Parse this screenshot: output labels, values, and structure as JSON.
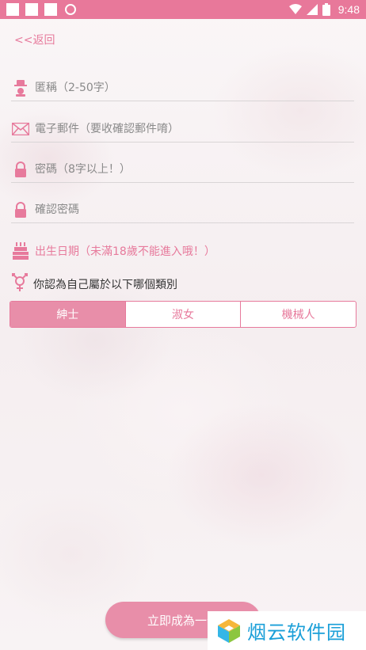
{
  "status_bar": {
    "time": "9:48",
    "icons": [
      "notification-square-icon",
      "notification-square-icon",
      "notification-square-icon",
      "sync-circle-icon",
      "wifi-icon",
      "signal-icon",
      "battery-icon"
    ]
  },
  "nav": {
    "back_label": "<<返回"
  },
  "form": {
    "nickname_placeholder": "匿稱（2-50字）",
    "email_placeholder": "電子郵件（要收確認郵件唷）",
    "password_placeholder": "密碼（8字以上！）",
    "confirm_password_placeholder": "確認密碼",
    "birthday_label": "出生日期（未滿18歲不能進入哦！）"
  },
  "gender": {
    "question": "你認為自己屬於以下哪個類別",
    "options": [
      "紳士",
      "淑女",
      "機械人"
    ],
    "selected": "紳士"
  },
  "submit": {
    "label": "立即成為一位"
  },
  "watermark": {
    "text": "烟云软件园"
  },
  "colors": {
    "accent": "#e88ea9",
    "accent_text": "#e77a9c",
    "status_bar": "#e8789a"
  }
}
